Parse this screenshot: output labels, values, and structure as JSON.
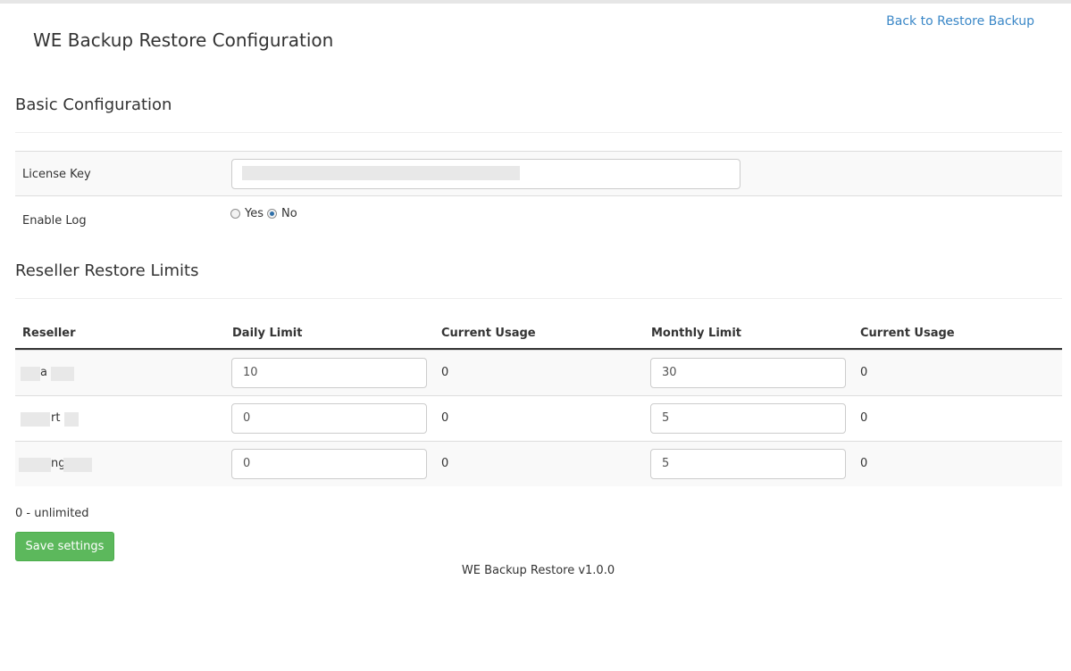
{
  "header": {
    "title": "WE Backup Restore Configuration",
    "back_link": "Back to Restore Backup"
  },
  "basic": {
    "heading": "Basic Configuration",
    "license_label": "License Key",
    "license_value": "",
    "enable_log_label": "Enable Log",
    "log_options": [
      "Yes",
      "No"
    ],
    "log_selected": "No"
  },
  "limits": {
    "heading": "Reseller Restore Limits",
    "columns": [
      "Reseller",
      "Daily Limit",
      "Current Usage",
      "Monthly Limit",
      "Current Usage"
    ],
    "rows": [
      {
        "reseller": "a",
        "daily_limit": "10",
        "daily_usage": "0",
        "monthly_limit": "30",
        "monthly_usage": "0"
      },
      {
        "reseller": "rt",
        "daily_limit": "0",
        "daily_usage": "0",
        "monthly_limit": "5",
        "monthly_usage": "0"
      },
      {
        "reseller": "ng",
        "daily_limit": "0",
        "daily_usage": "0",
        "monthly_limit": "5",
        "monthly_usage": "0"
      }
    ],
    "note": "0 - unlimited"
  },
  "actions": {
    "save_label": "Save settings"
  },
  "footer": {
    "version": "WE Backup Restore v1.0.0"
  },
  "colors": {
    "link": "#3a87c7",
    "save": "#5cb85c",
    "radio_checked": "#2f6fa8"
  }
}
